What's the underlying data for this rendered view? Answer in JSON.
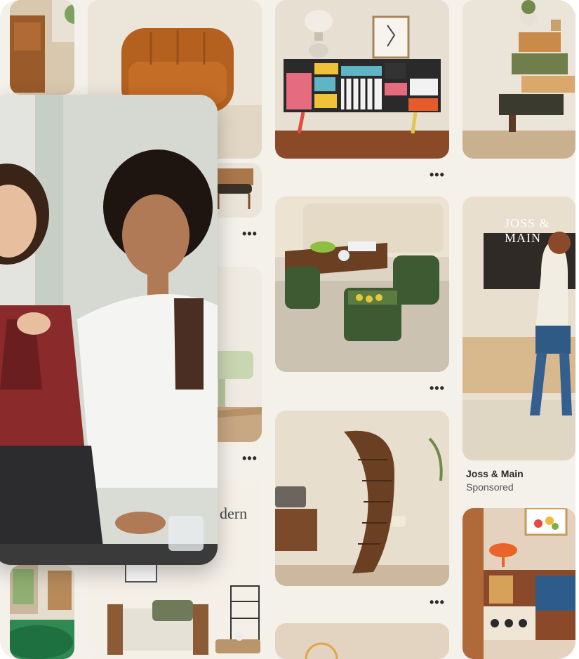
{
  "pins": {
    "more_label": "•••",
    "sponsored_pin": {
      "advertiser": "Joss & Main",
      "tag": "Sponsored",
      "overlay_text": "JOSS & MAIN"
    },
    "lamp_pin_text": "dern"
  },
  "colors": {
    "canvas": "#f4f0ea",
    "armchair": "#b4601f",
    "ottoman_green": "#3e5a32",
    "sofa_cream": "#ece3d2",
    "wood": "#6a3f22"
  }
}
